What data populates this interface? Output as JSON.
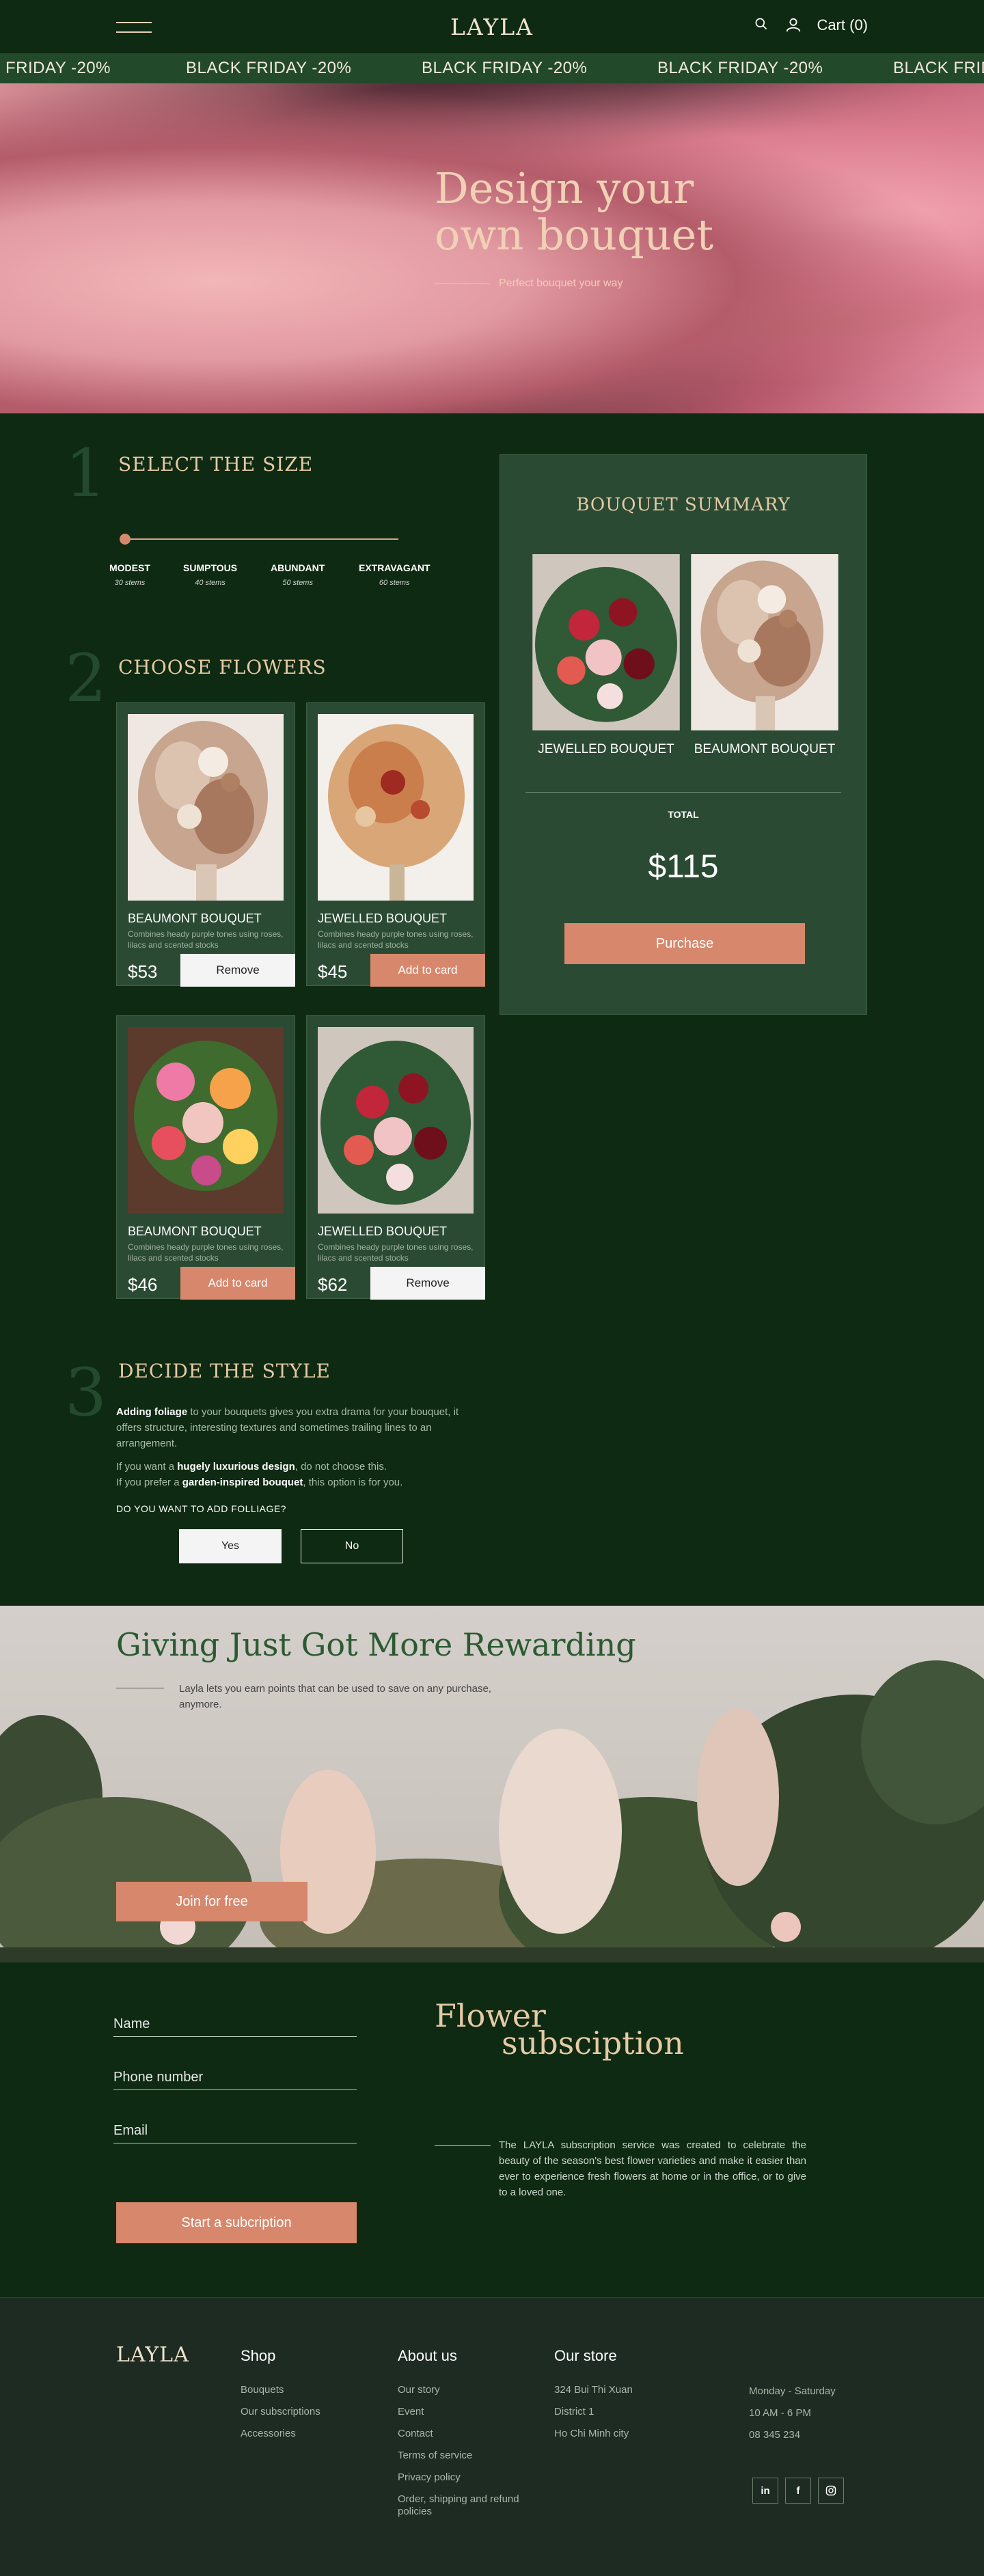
{
  "header": {
    "logo": "LAYLA",
    "cart_label": "Cart (0)",
    "icons": [
      "menu-icon",
      "search-icon",
      "user-icon"
    ]
  },
  "marquee": [
    "FRIDAY -20%",
    "BLACK FRIDAY -20%",
    "BLACK FRIDAY -20%",
    "BLACK FRIDAY -20%",
    "BLACK FRID"
  ],
  "hero": {
    "title": "Design your own bouquet",
    "subtitle": "Perfect bouquet your way"
  },
  "step1": {
    "number": "1",
    "title": "SELECT THE SIZE",
    "sizes": [
      {
        "name": "MODEST",
        "stems": "30 stems"
      },
      {
        "name": "SUMPTOUS",
        "stems": "40 stems"
      },
      {
        "name": "ABUNDANT",
        "stems": "50 stems"
      },
      {
        "name": "EXTRAVAGANT",
        "stems": "60 stems"
      }
    ]
  },
  "step2": {
    "number": "2",
    "title": "CHOOSE FLOWERS",
    "cards": [
      {
        "name": "BEAUMONT BOUQUET",
        "desc": "Combines heady purple tones using roses, lilacs and scented stocks",
        "price": "$53",
        "button": "Remove"
      },
      {
        "name": "JEWELLED BOUQUET",
        "desc": "Combines heady purple tones using roses, lilacs and scented stocks",
        "price": "$45",
        "button": "Add to card"
      },
      {
        "name": "BEAUMONT BOUQUET",
        "desc": "Combines heady purple tones using roses, lilacs and scented stocks",
        "price": "$46",
        "button": "Add to card"
      },
      {
        "name": "JEWELLED BOUQUET",
        "desc": "Combines heady purple tones using roses, lilacs and scented stocks",
        "price": "$62",
        "button": "Remove"
      }
    ]
  },
  "summary": {
    "title": "BOUQUET SUMMARY",
    "items": [
      "JEWELLED BOUQUET",
      "BEAUMONT BOUQUET"
    ],
    "total_label": "TOTAL",
    "total": "$115",
    "purchase_label": "Purchase"
  },
  "step3": {
    "number": "3",
    "title": "DECIDE THE STYLE",
    "p1_bold": "Adding foliage",
    "p1_rest": " to your bouquets gives you extra drama for your bouquet, it offers structure, interesting textures and sometimes trailing lines to an arrangement.",
    "p2_a": "If you want a ",
    "p2_bold": "hugely luxurious design",
    "p2_b": ", do not choose this.",
    "p3_a": "If you prefer a ",
    "p3_bold": "garden-inspired bouquet",
    "p3_b": ", this option is for you.",
    "question": "DO YOU WANT TO ADD FOLLIAGE?",
    "yes": "Yes",
    "no": "No"
  },
  "reward": {
    "title": "Giving Just Got More Rewarding",
    "subtitle": "Layla lets you earn points that can be used to save on any purchase, anymore.",
    "join_label": "Join for free"
  },
  "subscription": {
    "name_placeholder": "Name",
    "phone_placeholder": "Phone number",
    "email_placeholder": "Email",
    "submit_label": "Start a subcription",
    "title_line1": "Flower",
    "title_line2": "subsciption",
    "description": "The LAYLA subscription service was created to celebrate the beauty of the season's best flower varieties and make it easier than ever to experience fresh flowers at home or in the office, or to give to a loved one."
  },
  "footer": {
    "logo": "LAYLA",
    "shop": {
      "title": "Shop",
      "links": [
        "Bouquets",
        "Our subscriptions",
        "Accessories"
      ]
    },
    "about": {
      "title": "About us",
      "links": [
        "Our story",
        "Event",
        "Contact",
        "Terms of service",
        "Privacy policy",
        "Order, shipping and refund policies"
      ]
    },
    "store": {
      "title": "Our store",
      "address": [
        "324 Bui Thi Xuan",
        "District 1",
        "Ho Chi Minh city"
      ],
      "hours": [
        "Monday - Saturday",
        "10 AM - 6 PM",
        "08 345 234"
      ]
    },
    "socials": [
      "in",
      "f",
      "ig"
    ]
  }
}
